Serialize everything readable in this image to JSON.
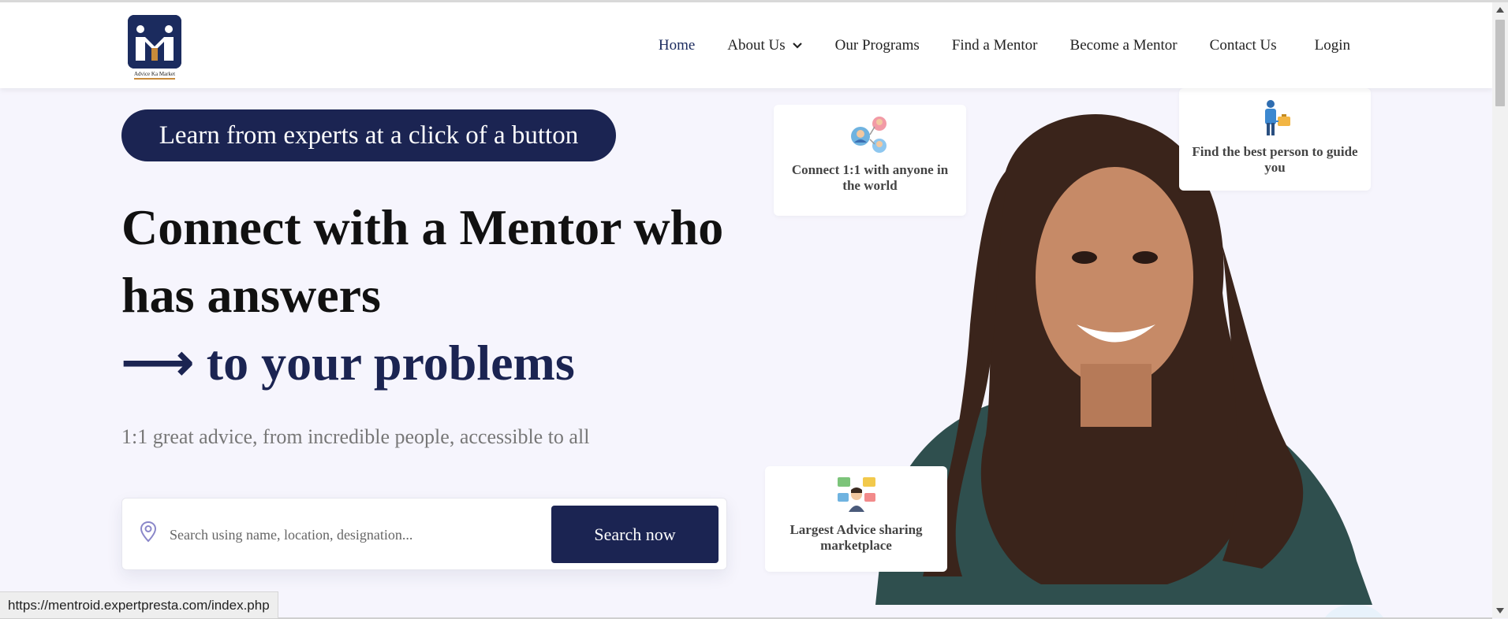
{
  "brand": {
    "logo_text": "Advice Ka Market",
    "primary_color": "#1b2452",
    "accent_color": "#c88a3a"
  },
  "nav": {
    "items": [
      {
        "label": "Home",
        "active": true
      },
      {
        "label": "About Us",
        "dropdown": true
      },
      {
        "label": "Our Programs"
      },
      {
        "label": "Find a Mentor"
      },
      {
        "label": "Become a Mentor"
      },
      {
        "label": "Contact Us"
      },
      {
        "label": "Login"
      }
    ]
  },
  "hero": {
    "pill": "Learn from experts at a click of a button",
    "headline_line1": "Connect with a Mentor who",
    "headline_line2": "has answers",
    "headline_line3": "⟶ to your problems",
    "subtext": "1:1 great advice, from incredible people, accessible to all"
  },
  "search": {
    "placeholder": "Search using name, location, designation...",
    "button_label": "Search now"
  },
  "cards": [
    {
      "text": "Connect 1:1 with anyone in the world",
      "icon": "people-network-icon"
    },
    {
      "text": "Find the best person to guide you",
      "icon": "person-briefcase-icon"
    },
    {
      "text": "Largest Advice sharing marketplace",
      "icon": "advice-chat-icon"
    }
  ],
  "status_bar": {
    "url": "https://mentroid.expertpresta.com/index.php"
  }
}
